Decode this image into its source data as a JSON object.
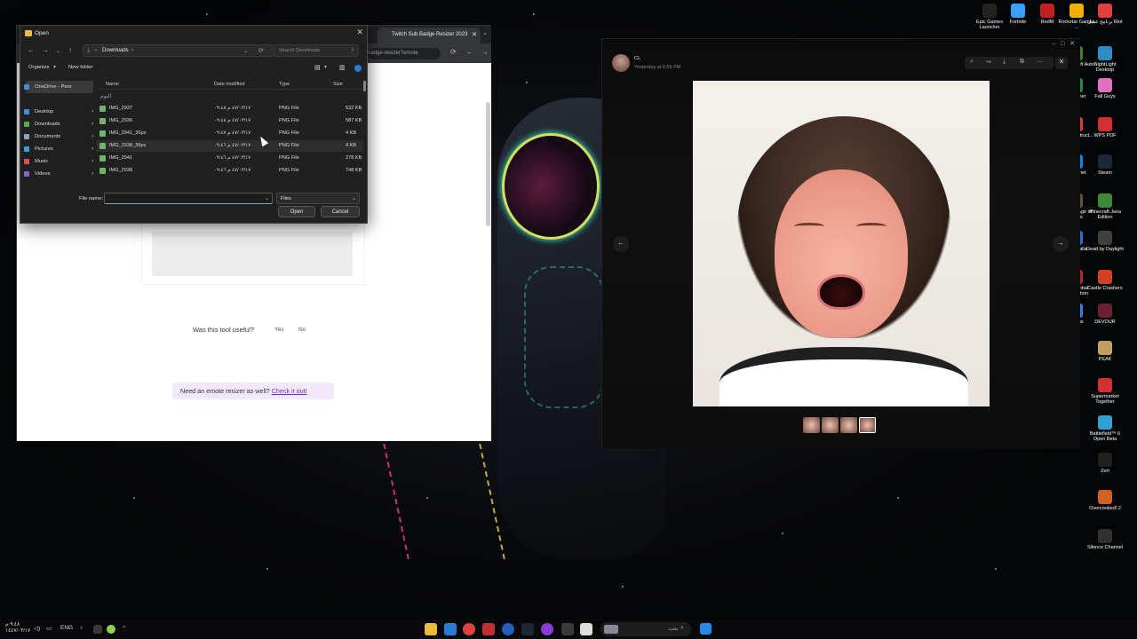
{
  "browser": {
    "tab_title": "Twitch Sub Badge Resizer 2023",
    "url_fragment": "badge-resizer?emote",
    "useful_question": "Was this tool useful?",
    "yes_label": "Yes",
    "no_label": "No",
    "banner_text": "Need an emote resizer as well?",
    "banner_link": "Check it out!"
  },
  "dialog": {
    "title": "Open",
    "path_folder": "Downloads",
    "search_placeholder": "Search Downloads",
    "organize_label": "Organize",
    "new_folder_label": "New folder",
    "sidebar": [
      {
        "label": "OneDrive - Pers",
        "color": "#3a8ee6"
      },
      {
        "label": "Desktop",
        "color": "#3a8ee6"
      },
      {
        "label": "Downloads",
        "color": "#4caf50"
      },
      {
        "label": "Documents",
        "color": "#8aa0c8"
      },
      {
        "label": "Pictures",
        "color": "#3aa0e0"
      },
      {
        "label": "Music",
        "color": "#e05050"
      },
      {
        "label": "Videos",
        "color": "#9060d0"
      }
    ],
    "columns": {
      "name": "Name",
      "date": "Date modified",
      "type": "Type",
      "size": "Size"
    },
    "group_label": "اليوم",
    "files": [
      {
        "name": "IMG_2937",
        "date": "٤٧/٠٣/١٧ م ٠٩:٤٨",
        "type": "PNG File",
        "size": "532 KB"
      },
      {
        "name": "IMG_2936",
        "date": "٤٧/٠٣/١٧ م ٠٩:٤٨",
        "type": "PNG File",
        "size": "587 KB"
      },
      {
        "name": "IMG_2941_36px",
        "date": "٤٧/٠٣/١٧ م ٠٩:٤٧",
        "type": "PNG File",
        "size": "4 KB"
      },
      {
        "name": "IMG_2938_36px",
        "date": "٤٧/٠٣/١٧ م ٠٩:٤٦",
        "type": "PNG File",
        "size": "4 KB"
      },
      {
        "name": "IMG_2941",
        "date": "٤٧/٠٣/١٧ م ٠٩:٤٦",
        "type": "PNG File",
        "size": "278 KB"
      },
      {
        "name": "IMG_2938",
        "date": "٤٧/٠٣/١٧ م ٠٩:٤٦",
        "type": "PNG File",
        "size": "748 KB"
      }
    ],
    "file_name_label": "File name:",
    "file_name_value": "",
    "filter_value": "Files",
    "open_label": "Open",
    "cancel_label": "Cancel"
  },
  "viewer": {
    "user": "CL",
    "timestamp": "Yesterday at 6:59 PM"
  },
  "desktop_icons": [
    {
      "label": "Epic Games Launcher",
      "color": "#222"
    },
    {
      "label": "Fortnite",
      "color": "#3aa0ff"
    },
    {
      "label": "RedM",
      "color": "#c02020"
    },
    {
      "label": "Rockstar Games ...",
      "color": "#f0b000"
    },
    {
      "label": "برنامج عميل Riot",
      "color": "#e04040"
    },
    {
      "label": "Grand Theft Auto V",
      "color": "#4a7a30"
    },
    {
      "label": "NightLight Desktop",
      "color": "#2c8cc4"
    },
    {
      "label": "Launcher",
      "color": "#2a8a40"
    },
    {
      "label": "Fall Guys",
      "color": "#e070c0"
    },
    {
      "label": "Bridge Instruct...",
      "color": "#d04040"
    },
    {
      "label": "WPS PDF",
      "color": "#d03030"
    },
    {
      "label": "Battle.net",
      "color": "#1a80e0"
    },
    {
      "label": "Steam",
      "color": "#1b2838"
    },
    {
      "label": "Century Age of Ashes",
      "color": "#605040"
    },
    {
      "label": "Minecraft Java Edition",
      "color": "#3a8a3a"
    },
    {
      "label": "Brawlhalla",
      "color": "#3a6ac0"
    },
    {
      "label": "Dead by Daylight",
      "color": "#404040"
    },
    {
      "label": "ASK Global Domination",
      "color": "#a03030"
    },
    {
      "label": "Castle Crashers",
      "color": "#d04020"
    },
    {
      "label": "Photos",
      "color": "#3a80d0"
    },
    {
      "label": "DEVOUR",
      "color": "#6a2030"
    },
    {
      "label": "PEAK",
      "color": "#c0a060"
    },
    {
      "label": "Supermarket Together",
      "color": "#d03030"
    },
    {
      "label": "Battlefield™ 6 Open Beta",
      "color": "#30a0d0"
    },
    {
      "label": "Zort",
      "color": "#202020"
    },
    {
      "label": "Overcooked! 2",
      "color": "#d06020"
    },
    {
      "label": "Silence Channel",
      "color": "#303030"
    }
  ],
  "taskbar": {
    "time": "٩:٤٨ م",
    "date": "١٤٤٧/٠٣/١٧",
    "lang": "ENG",
    "search_placeholder": "بحث"
  }
}
